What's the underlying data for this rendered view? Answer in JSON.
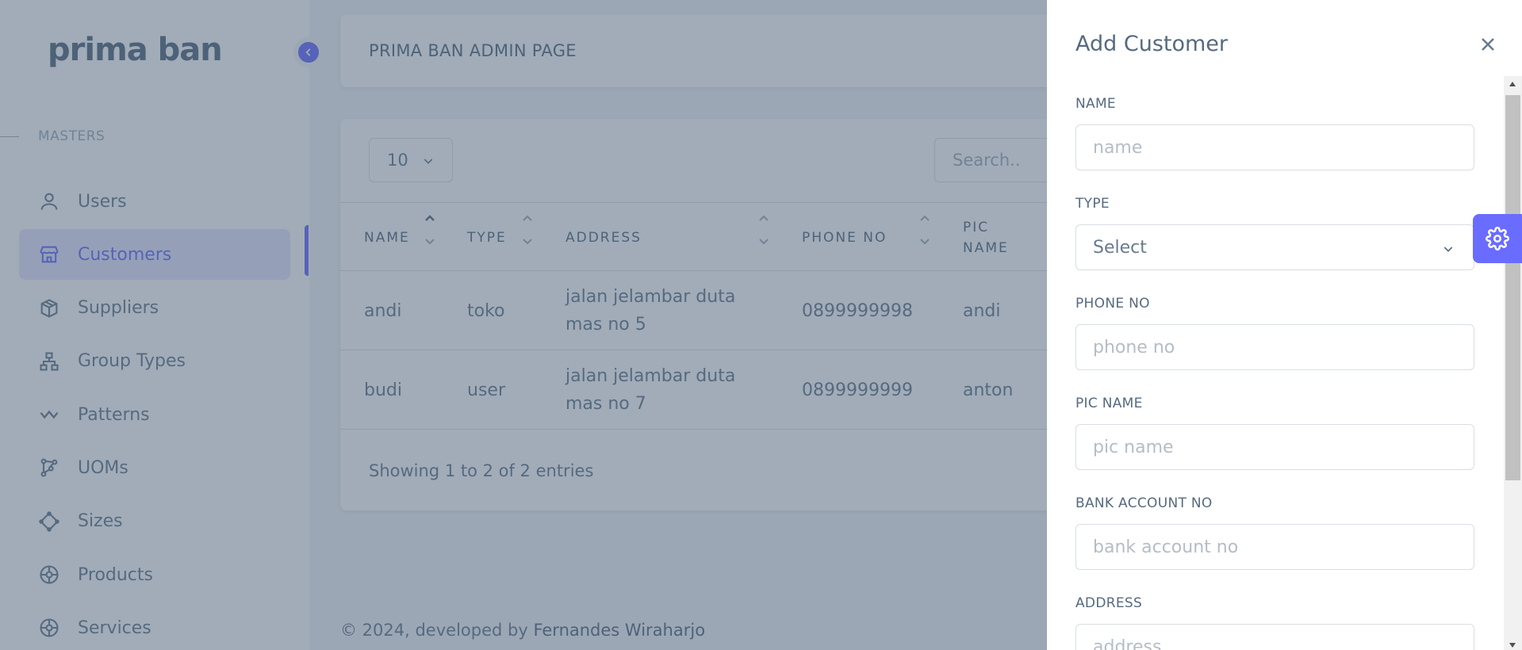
{
  "sidebar": {
    "brand": "prima ban",
    "section_header": "MASTERS",
    "items": [
      {
        "label": "Users",
        "icon": "user-icon"
      },
      {
        "label": "Customers",
        "icon": "store-icon",
        "active": true
      },
      {
        "label": "Suppliers",
        "icon": "box-icon"
      },
      {
        "label": "Group Types",
        "icon": "sitemap-icon"
      },
      {
        "label": "Patterns",
        "icon": "pattern-icon"
      },
      {
        "label": "UOMs",
        "icon": "network-icon"
      },
      {
        "label": "Sizes",
        "icon": "shape-icon"
      },
      {
        "label": "Products",
        "icon": "tire-icon"
      },
      {
        "label": "Services",
        "icon": "tire-icon"
      }
    ]
  },
  "header": {
    "title": "PRIMA BAN ADMIN PAGE"
  },
  "table": {
    "page_length": "10",
    "search_placeholder": "Search..",
    "columns": [
      "NAME",
      "TYPE",
      "ADDRESS",
      "PHONE NO",
      "PIC NAME"
    ],
    "rows": [
      {
        "name": "andi",
        "type": "toko",
        "address": "jalan jelambar duta mas no 5",
        "phone": "0899999998",
        "pic": "andi"
      },
      {
        "name": "budi",
        "type": "user",
        "address": "jalan jelambar duta mas no 7",
        "phone": "0899999999",
        "pic": "anton"
      }
    ],
    "entries_info": "Showing 1 to 2 of 2 entries"
  },
  "footer": {
    "prefix": "© 2024, developed by ",
    "author": "Fernandes Wiraharjo"
  },
  "offcanvas": {
    "title": "Add Customer",
    "fields": [
      {
        "label": "NAME",
        "placeholder": "name"
      },
      {
        "label": "TYPE",
        "value": "Select"
      },
      {
        "label": "PHONE NO",
        "placeholder": "phone no"
      },
      {
        "label": "PIC NAME",
        "placeholder": "pic name"
      },
      {
        "label": "BANK ACCOUNT NO",
        "placeholder": "bank account no"
      },
      {
        "label": "ADDRESS",
        "placeholder": "address"
      }
    ]
  },
  "colors": {
    "accent": "#696cff",
    "overlay": "#435971",
    "text": "#566a7f"
  }
}
